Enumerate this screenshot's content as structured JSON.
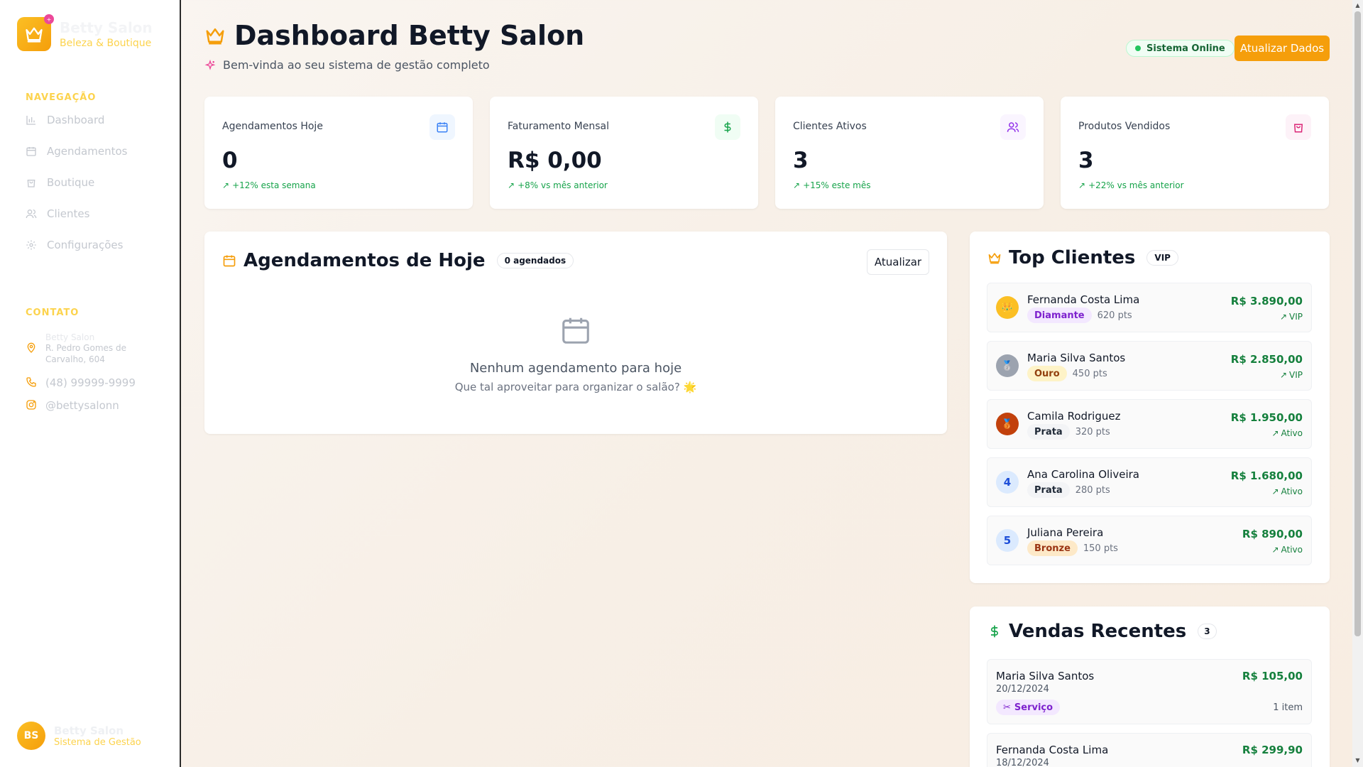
{
  "brand": {
    "name": "Betty Salon",
    "subtitle": "Beleza & Boutique",
    "badge": "+"
  },
  "sidebar": {
    "nav_title": "NAVEGAÇÃO",
    "items": [
      {
        "label": "Dashboard",
        "icon": "chart-icon"
      },
      {
        "label": "Agendamentos",
        "icon": "calendar-icon"
      },
      {
        "label": "Boutique",
        "icon": "shopping-bag-icon"
      },
      {
        "label": "Clientes",
        "icon": "users-icon"
      },
      {
        "label": "Configurações",
        "icon": "gear-icon"
      }
    ],
    "contact_title": "CONTATO",
    "contact": {
      "address_title": "Betty Salon",
      "address": "R. Pedro Gomes de Carvalho, 604",
      "phone": "(48) 99999-9999",
      "instagram": "@bettysalonn"
    },
    "user": {
      "initials": "BS",
      "name": "Betty Salon",
      "role": "Sistema de Gestão"
    }
  },
  "header": {
    "title": "Dashboard Betty Salon",
    "subtitle": "Bem-vinda ao seu sistema de gestão completo",
    "status": "Sistema Online",
    "refresh_label": "Atualizar Dados"
  },
  "stats": [
    {
      "label": "Agendamentos Hoje",
      "value": "0",
      "trend": "+12% esta semana",
      "icon": "calendar-icon",
      "color": "#3b82f6",
      "bg": "#eff6ff"
    },
    {
      "label": "Faturamento Mensal",
      "value": "R$ 0,00",
      "trend": "+8% vs mês anterior",
      "icon": "dollar-icon",
      "color": "#16a34a",
      "bg": "#f0fdf4"
    },
    {
      "label": "Clientes Ativos",
      "value": "3",
      "trend": "+15% este mês",
      "icon": "users-icon",
      "color": "#9333ea",
      "bg": "#faf5ff"
    },
    {
      "label": "Produtos Vendidos",
      "value": "3",
      "trend": "+22% vs mês anterior",
      "icon": "shopping-bag-icon",
      "color": "#db2777",
      "bg": "#fdf2f8"
    }
  ],
  "appointments": {
    "title": "Agendamentos de Hoje",
    "count_badge": "0 agendados",
    "refresh_label": "Atualizar",
    "empty_title": "Nenhum agendamento para hoje",
    "empty_sub": "Que tal aproveitar para organizar o salão? 🌟"
  },
  "top_clients": {
    "title": "Top Clientes",
    "badge": "VIP",
    "items": [
      {
        "rank": "👑",
        "name": "Fernanda Costa Lima",
        "tier": "Diamante",
        "points": "620 pts",
        "amount": "R$ 3.890,00",
        "status": "VIP",
        "tier_bg": "#f3e8ff",
        "tier_color": "#7e22ce",
        "rank_bg": "#fbbf24",
        "rank_color": "#ffffff"
      },
      {
        "rank": "🥈",
        "name": "Maria Silva Santos",
        "tier": "Ouro",
        "points": "450 pts",
        "amount": "R$ 2.850,00",
        "status": "VIP",
        "tier_bg": "#fef3c7",
        "tier_color": "#92400e",
        "rank_bg": "#9ca3af",
        "rank_color": "#ffffff"
      },
      {
        "rank": "🥉",
        "name": "Camila Rodriguez",
        "tier": "Prata",
        "points": "320 pts",
        "amount": "R$ 1.950,00",
        "status": "Ativo",
        "tier_bg": "#f3f4f6",
        "tier_color": "#1f2937",
        "rank_bg": "#c2410c",
        "rank_color": "#ffffff"
      },
      {
        "rank": "4",
        "name": "Ana Carolina Oliveira",
        "tier": "Prata",
        "points": "280 pts",
        "amount": "R$ 1.680,00",
        "status": "Ativo",
        "tier_bg": "#f3f4f6",
        "tier_color": "#1f2937",
        "rank_bg": "#dbeafe",
        "rank_color": "#1d4ed8"
      },
      {
        "rank": "5",
        "name": "Juliana Pereira",
        "tier": "Bronze",
        "points": "150 pts",
        "amount": "R$ 890,00",
        "status": "Ativo",
        "tier_bg": "#fde9c8",
        "tier_color": "#9a3412",
        "rank_bg": "#dbeafe",
        "rank_color": "#1d4ed8"
      }
    ]
  },
  "recent_sales": {
    "title": "Vendas Recentes",
    "count": "3",
    "items": [
      {
        "name": "Maria Silva Santos",
        "date": "20/12/2024",
        "amount": "R$ 105,00",
        "type": "Serviço",
        "items": "1 item"
      },
      {
        "name": "Fernanda Costa Lima",
        "date": "18/12/2024",
        "amount": "R$ 299,90"
      }
    ]
  }
}
